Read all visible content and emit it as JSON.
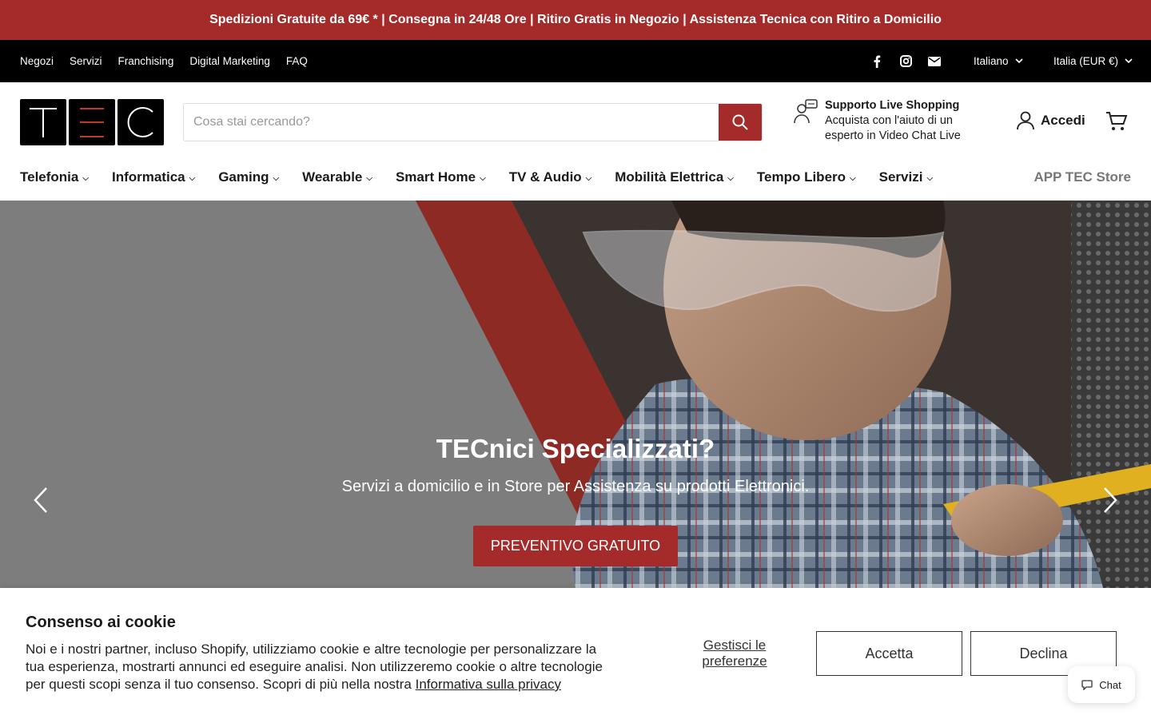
{
  "announcement": "Spedizioni Gratuite da 69€ * | Consegna in 24/48 Ore | Ritiro Gratis in Negozio | Assistenza Tecnica con Ritiro a Domicilio",
  "utility": {
    "links": [
      "Negozi",
      "Servizi",
      "Franchising",
      "Digital Marketing",
      "FAQ"
    ],
    "social_icons": [
      "facebook-icon",
      "instagram-icon",
      "email-icon"
    ],
    "language": "Italiano",
    "country": "Italia (EUR €)"
  },
  "header": {
    "logo_letters": [
      "T",
      "E",
      "C"
    ],
    "search_placeholder": "Cosa stai cercando?",
    "support_title": "Supporto Live Shopping",
    "support_line1": "Acquista con l'aiuto di un",
    "support_line2": "esperto in Video Chat Live",
    "account_label": "Accedi"
  },
  "nav": {
    "items": [
      "Telefonia",
      "Informatica",
      "Gaming",
      "Wearable",
      "Smart Home",
      "TV & Audio",
      "Mobilità Elettrica",
      "Tempo Libero",
      "Servizi"
    ],
    "app_link": "APP TEC Store"
  },
  "hero": {
    "title": "TECnici Specializzati?",
    "subtitle": "Servizi a domicilio e in Store per Assistenza su prodotti Elettronici.",
    "cta": "PREVENTIVO GRATUITO"
  },
  "cookie": {
    "title": "Consenso ai cookie",
    "body": "Noi e i nostri partner, incluso Shopify, utilizziamo cookie e altre tecnologie per personalizzare la tua esperienza, mostrarti annunci ed eseguire analisi. Non utilizzeremo cookie o altre tecnologie per questi scopi senza il tuo consenso. Scopri di più nella nostra",
    "privacy_link": "Informativa sulla privacy",
    "preferences": "Gestisci le preferenze",
    "accept": "Accetta",
    "decline": "Declina"
  },
  "chat_label": "Chat",
  "colors": {
    "brand_red": "#a52a2a",
    "black": "#000000",
    "nav_muted": "#777777"
  }
}
